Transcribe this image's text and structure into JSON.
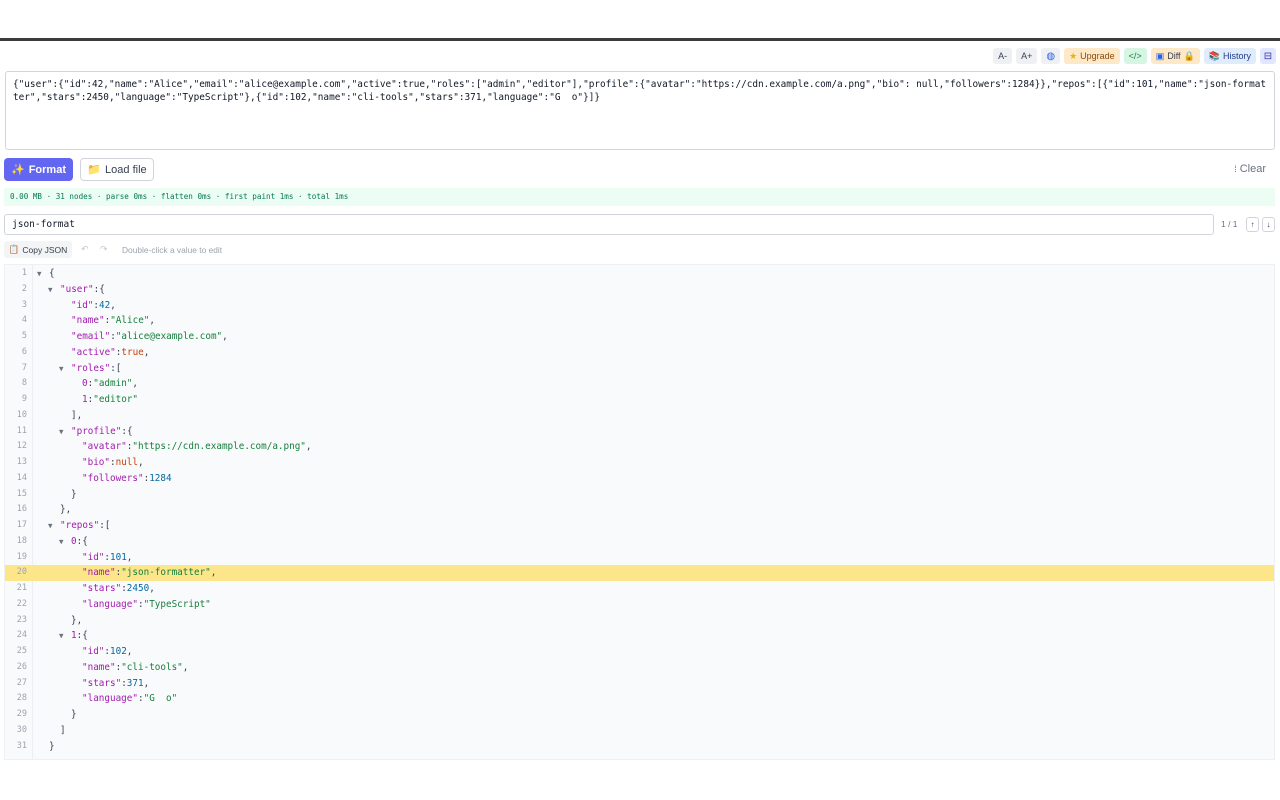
{
  "toolbar": {
    "font_smaller": "A-",
    "font_larger": "A+",
    "upgrade": "Upgrade",
    "code": "</>",
    "diff": "Diff",
    "history": "History"
  },
  "raw_input": "{\"user\":{\"id\":42,\"name\":\"Alice\",\"email\":\"alice@example.com\",\"active\":true,\"roles\":[\"admin\",\"editor\"],\"profile\":{\"avatar\":\"https://cdn.example.com/a.png\",\"bio\": null,\"followers\":1284}},\"repos\":[{\"id\":101,\"name\":\"json-formatter\",\"stars\":2450,\"language\":\"TypeScript\"},{\"id\":102,\"name\":\"cli-tools\",\"stars\":371,\"language\":\"G  o\"}]}",
  "actions": {
    "format": "Format",
    "load_file": "Load file",
    "clear": "Clear"
  },
  "stats": "0.00 MB · 31 nodes · parse 0ms · flatten 0ms · first paint 1ms · total 1ms",
  "search": {
    "value": "json-format",
    "count": "1 / 1",
    "prev": "↑",
    "next": "↓"
  },
  "secondary": {
    "copy": "Copy JSON",
    "undo": "↶",
    "redo": "↷",
    "hint": "Double-click a value to edit"
  },
  "highlight_line": 20,
  "tree": [
    {
      "ln": "1",
      "indent": 0,
      "toggle": true,
      "tokens": [
        [
          "p",
          "{"
        ]
      ]
    },
    {
      "ln": "2",
      "indent": 1,
      "toggle": true,
      "tokens": [
        [
          "k",
          "\"user\""
        ],
        [
          "p",
          ":{"
        ]
      ]
    },
    {
      "ln": "3",
      "indent": 2,
      "toggle": false,
      "tokens": [
        [
          "k",
          "\"id\""
        ],
        [
          "p",
          ":"
        ],
        [
          "n",
          "42"
        ],
        [
          "p",
          ","
        ]
      ]
    },
    {
      "ln": "4",
      "indent": 2,
      "toggle": false,
      "tokens": [
        [
          "k",
          "\"name\""
        ],
        [
          "p",
          ":"
        ],
        [
          "s",
          "\"Alice\""
        ],
        [
          "p",
          ","
        ]
      ]
    },
    {
      "ln": "5",
      "indent": 2,
      "toggle": false,
      "tokens": [
        [
          "k",
          "\"email\""
        ],
        [
          "p",
          ":"
        ],
        [
          "s",
          "\"alice@example.com\""
        ],
        [
          "p",
          ","
        ]
      ]
    },
    {
      "ln": "6",
      "indent": 2,
      "toggle": false,
      "tokens": [
        [
          "k",
          "\"active\""
        ],
        [
          "p",
          ":"
        ],
        [
          "b",
          "true"
        ],
        [
          "p",
          ","
        ]
      ]
    },
    {
      "ln": "7",
      "indent": 2,
      "toggle": true,
      "tokens": [
        [
          "k",
          "\"roles\""
        ],
        [
          "p",
          ":["
        ]
      ]
    },
    {
      "ln": "8",
      "indent": 3,
      "toggle": false,
      "tokens": [
        [
          "k",
          "0"
        ],
        [
          "p",
          ":"
        ],
        [
          "s",
          "\"admin\""
        ],
        [
          "p",
          ","
        ]
      ]
    },
    {
      "ln": "9",
      "indent": 3,
      "toggle": false,
      "tokens": [
        [
          "k",
          "1"
        ],
        [
          "p",
          ":"
        ],
        [
          "s",
          "\"editor\""
        ]
      ]
    },
    {
      "ln": "10",
      "indent": 2,
      "toggle": false,
      "tokens": [
        [
          "p",
          "],"
        ]
      ]
    },
    {
      "ln": "11",
      "indent": 2,
      "toggle": true,
      "tokens": [
        [
          "k",
          "\"profile\""
        ],
        [
          "p",
          ":{"
        ]
      ]
    },
    {
      "ln": "12",
      "indent": 3,
      "toggle": false,
      "tokens": [
        [
          "k",
          "\"avatar\""
        ],
        [
          "p",
          ":"
        ],
        [
          "s",
          "\"https://cdn.example.com/a.png\""
        ],
        [
          "p",
          ","
        ]
      ]
    },
    {
      "ln": "13",
      "indent": 3,
      "toggle": false,
      "tokens": [
        [
          "k",
          "\"bio\""
        ],
        [
          "p",
          ":"
        ],
        [
          "b",
          "null"
        ],
        [
          "p",
          ","
        ]
      ]
    },
    {
      "ln": "14",
      "indent": 3,
      "toggle": false,
      "tokens": [
        [
          "k",
          "\"followers\""
        ],
        [
          "p",
          ":"
        ],
        [
          "n",
          "1284"
        ]
      ]
    },
    {
      "ln": "15",
      "indent": 2,
      "toggle": false,
      "tokens": [
        [
          "p",
          "}"
        ]
      ]
    },
    {
      "ln": "16",
      "indent": 1,
      "toggle": false,
      "tokens": [
        [
          "p",
          "},"
        ]
      ]
    },
    {
      "ln": "17",
      "indent": 1,
      "toggle": true,
      "tokens": [
        [
          "k",
          "\"repos\""
        ],
        [
          "p",
          ":["
        ]
      ]
    },
    {
      "ln": "18",
      "indent": 2,
      "toggle": true,
      "tokens": [
        [
          "k",
          "0"
        ],
        [
          "p",
          ":{"
        ]
      ]
    },
    {
      "ln": "19",
      "indent": 3,
      "toggle": false,
      "tokens": [
        [
          "k",
          "\"id\""
        ],
        [
          "p",
          ":"
        ],
        [
          "n",
          "101"
        ],
        [
          "p",
          ","
        ]
      ]
    },
    {
      "ln": "20",
      "indent": 3,
      "toggle": false,
      "tokens": [
        [
          "k",
          "\"name\""
        ],
        [
          "p",
          ":"
        ],
        [
          "s",
          "\"json-formatter\""
        ],
        [
          "p",
          ","
        ]
      ]
    },
    {
      "ln": "21",
      "indent": 3,
      "toggle": false,
      "tokens": [
        [
          "k",
          "\"stars\""
        ],
        [
          "p",
          ":"
        ],
        [
          "n",
          "2450"
        ],
        [
          "p",
          ","
        ]
      ]
    },
    {
      "ln": "22",
      "indent": 3,
      "toggle": false,
      "tokens": [
        [
          "k",
          "\"language\""
        ],
        [
          "p",
          ":"
        ],
        [
          "s",
          "\"TypeScript\""
        ]
      ]
    },
    {
      "ln": "23",
      "indent": 2,
      "toggle": false,
      "tokens": [
        [
          "p",
          "},"
        ]
      ]
    },
    {
      "ln": "24",
      "indent": 2,
      "toggle": true,
      "tokens": [
        [
          "k",
          "1"
        ],
        [
          "p",
          ":{"
        ]
      ]
    },
    {
      "ln": "25",
      "indent": 3,
      "toggle": false,
      "tokens": [
        [
          "k",
          "\"id\""
        ],
        [
          "p",
          ":"
        ],
        [
          "n",
          "102"
        ],
        [
          "p",
          ","
        ]
      ]
    },
    {
      "ln": "26",
      "indent": 3,
      "toggle": false,
      "tokens": [
        [
          "k",
          "\"name\""
        ],
        [
          "p",
          ":"
        ],
        [
          "s",
          "\"cli-tools\""
        ],
        [
          "p",
          ","
        ]
      ]
    },
    {
      "ln": "27",
      "indent": 3,
      "toggle": false,
      "tokens": [
        [
          "k",
          "\"stars\""
        ],
        [
          "p",
          ":"
        ],
        [
          "n",
          "371"
        ],
        [
          "p",
          ","
        ]
      ]
    },
    {
      "ln": "28",
      "indent": 3,
      "toggle": false,
      "tokens": [
        [
          "k",
          "\"language\""
        ],
        [
          "p",
          ":"
        ],
        [
          "s",
          "\"G  o\""
        ]
      ]
    },
    {
      "ln": "29",
      "indent": 2,
      "toggle": false,
      "tokens": [
        [
          "p",
          "}"
        ]
      ]
    },
    {
      "ln": "30",
      "indent": 1,
      "toggle": false,
      "tokens": [
        [
          "p",
          "]"
        ]
      ]
    },
    {
      "ln": "31",
      "indent": 0,
      "toggle": false,
      "tokens": [
        [
          "p",
          "}"
        ]
      ]
    }
  ]
}
